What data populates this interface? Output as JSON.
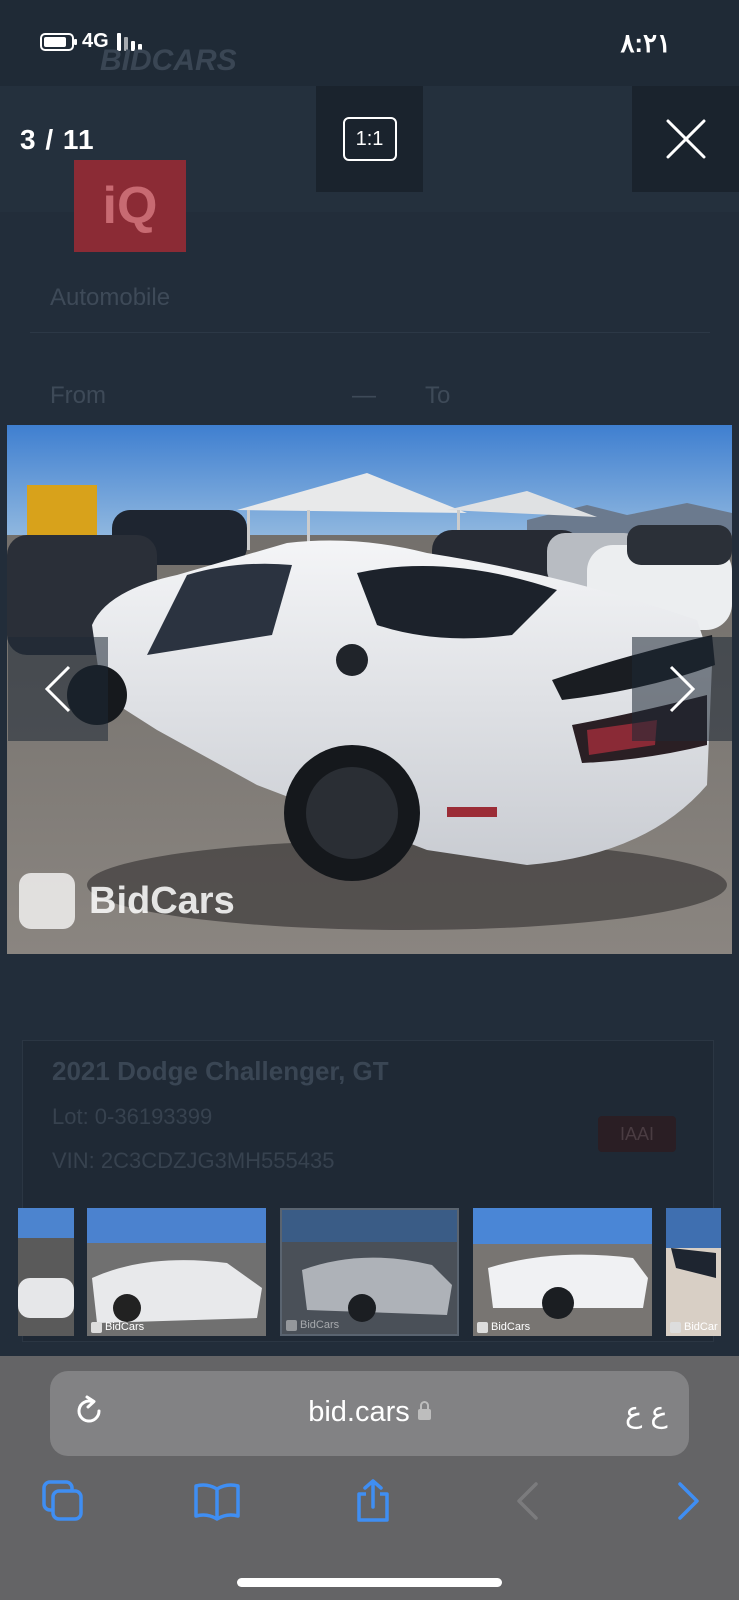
{
  "status_bar": {
    "network": "4G",
    "time": "٨:٢١"
  },
  "background_page": {
    "brand": "BIDCARS",
    "logo_text": "iQ",
    "filter_type": "Automobile",
    "range_from": "From",
    "range_separator": "—",
    "range_to": "To",
    "listing_title": "2021 Dodge Challenger, GT",
    "lot": "Lot: 0-36193399",
    "vin": "VIN: 2C3CDZJG3MH555435",
    "auction_badge": "IAAI"
  },
  "viewer": {
    "counter": "3 / 11",
    "ratio_label": "1:1",
    "watermark": "BidCars",
    "thumbnails": [
      {
        "watermark": ""
      },
      {
        "watermark": "BidCars"
      },
      {
        "watermark": "BidCars"
      },
      {
        "watermark": "BidCars"
      },
      {
        "watermark": "BidCar"
      }
    ]
  },
  "browser": {
    "url": "bid.cars",
    "text_size_label": "ع ع"
  },
  "colors": {
    "accent": "#3f8ef3",
    "backdrop": "#1d2733",
    "chrome": "#646466"
  }
}
